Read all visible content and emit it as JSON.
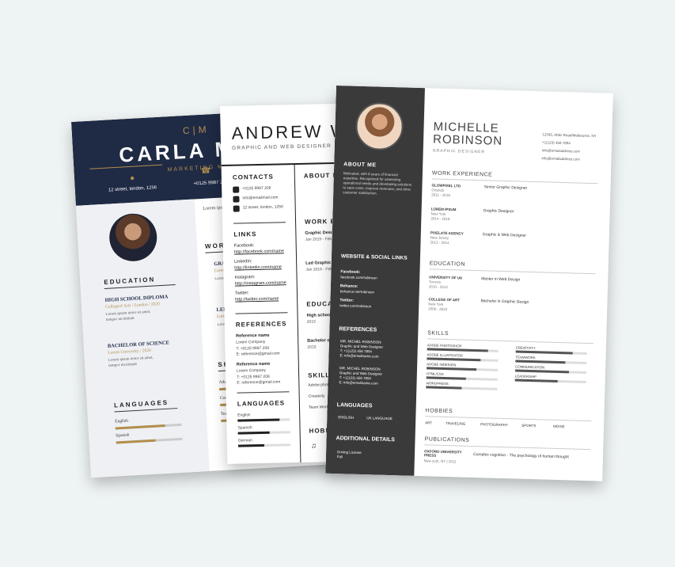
{
  "carla": {
    "monogram": "C|M",
    "name": "CARLA MO",
    "title": "MARKETING MANA",
    "address": "12 street, london, 1256",
    "phone": "+0125 9987 208",
    "education_heading": "EDUCATION",
    "edu": [
      {
        "title": "HIGH SCHOOL DIPLOMA",
        "sub": "Collegeof Arts / London / 2020",
        "text1": "Lorem ipsum dolor sit amet,",
        "text2": "tempor incididunt"
      },
      {
        "title": "BACHELOR OF SCIENCE",
        "sub": "Lorem University / 2020",
        "text1": "Lorem ipsum dolor sit amet,",
        "text2": "tempor incididunt"
      }
    ],
    "languages_heading": "LANGUAGES",
    "langs": [
      {
        "name": "English",
        "level": 0.75
      },
      {
        "name": "Spanish",
        "level": 0.6
      }
    ],
    "exp_heading": "WORK EXPE",
    "exp": [
      {
        "title": "GRAPHIC DE",
        "sub": "Lorem Compane"
      },
      {
        "title": "LED GRAPH",
        "sub": "Lorem Compa"
      }
    ],
    "skills_heading": "SKILLS",
    "skills": [
      {
        "name": "Adobe photosh",
        "level": 0.8
      },
      {
        "name": "Creativity",
        "level": 0.6
      },
      {
        "name": "Team Work",
        "level": 0.7
      }
    ],
    "intro": "Lorem ipsum dolor sit"
  },
  "andrew": {
    "name": "ANDREW WAT",
    "title": "GRAPHIC AND WEB DESIGNER",
    "contacts_heading": "CONTACTS",
    "contacts": [
      "+0125 9987 208",
      "info@emailmail.com",
      "12 street, london, 1256"
    ],
    "links_heading": "LINKS",
    "links": [
      {
        "label": "Facebook:",
        "url": "http://facebook.com/name"
      },
      {
        "label": "LinkedIn:",
        "url": "http://linkedin.com/name"
      },
      {
        "label": "Instagram:",
        "url": "http://instagram.com/name"
      },
      {
        "label": "Twitter:",
        "url": "http://twitter.com/name"
      }
    ],
    "references_heading": "REFERENCES",
    "refs": [
      {
        "name": "Reference name",
        "company": "Lorem Company",
        "t": "T: +0125 9987 208",
        "e": "E: reference@gmail.com"
      },
      {
        "name": "Reference name",
        "company": "Lorem Company",
        "t": "T: +0125 9987 208",
        "e": "E: reference@gmail.com"
      }
    ],
    "languages_heading": "LANGUAGES",
    "langs": [
      {
        "name": "English",
        "level": 0.8
      },
      {
        "name": "Spanish",
        "level": 0.6
      },
      {
        "name": "German",
        "level": 0.5
      }
    ],
    "about_heading": "ABOUT ME",
    "work_heading": "WORK EXP",
    "work": [
      {
        "title": "Graphic Designe",
        "dates": "Jan 2019 - Feb 20"
      },
      {
        "title": "Led Graphic De",
        "dates": "Jan 2018 - Feb 20"
      }
    ],
    "edu_heading": "EDUCATI",
    "edu": [
      {
        "title": "High school",
        "dates": "2019"
      },
      {
        "title": "Bachelor of",
        "dates": "2019"
      }
    ],
    "skills_heading": "SKILLS",
    "skills": [
      "Adobe photo",
      "Creativity",
      "Team Work"
    ],
    "hobbies_heading": "HOBBI"
  },
  "michelle": {
    "name1": "MICHELLE",
    "name2": "ROBINSON",
    "title": "GRAPHIC DESIGNER",
    "contacts": [
      "12345, Abbs Road/Melbourne, NY",
      "+1(123) 456 7894",
      "info@emailaddress.com",
      "info@emailaddress.com"
    ],
    "about_heading": "ABOUT ME",
    "about_text": "Motivated, with 8 years of financial expertise. Recognized for assessing operational needs and developing solutions to save costs, improve revenues, and drive customer satisfaction.",
    "web_heading": "WEBSITE & SOCIAL LINKS",
    "web": [
      {
        "label": "Facebook:",
        "url": "facebook.com/robinson"
      },
      {
        "label": "Behance:",
        "url": "behance.net/robinson"
      },
      {
        "label": "Twitter:",
        "url": "twitter.com/robinson"
      }
    ],
    "ref_heading": "REFERENCES",
    "refs": [
      {
        "name": "MR. MICHEL ROBINSON",
        "role": "Graphic and Web Designer",
        "t": "T: +1(123) 456 7894",
        "e": "E: info@emailname.com"
      },
      {
        "name": "MR. MICHEL ROBINSON",
        "role": "Graphic and Web Designer",
        "t": "T: +1(123) 456 7894",
        "e": "E: info@emailname.com"
      }
    ],
    "lang_heading": "LANGUAGES",
    "langs": [
      "ENGLISH",
      "UK LANGUAGE"
    ],
    "add_heading": "ADDITIONAL DETAILS",
    "add": [
      "Driving License",
      "Full"
    ],
    "work_heading": "WORK EXPERIENCE",
    "work": [
      {
        "company": "GLOWPIXEL LTD",
        "place": "Orlando",
        "years": "2011 - 2016",
        "role": "Senior Graphic Designer"
      },
      {
        "company": "LOREM IPSUM",
        "place": "New York",
        "years": "2014 - 2016",
        "role": "Graphic Designer"
      },
      {
        "company": "PIXELATE AGENCY",
        "place": "New Jersey",
        "years": "2013 - 2014",
        "role": "Graphic & Web Designer"
      }
    ],
    "edu_heading": "EDUCATION",
    "edu": [
      {
        "school": "UNIVERSITY OF UK",
        "place": "Toronto",
        "years": "2010 - 2012",
        "degree": "Master in Web Design"
      },
      {
        "school": "COLLEGE OF ART",
        "place": "New York",
        "years": "2006 - 2010",
        "degree": "Bachelor in Graphic Design"
      }
    ],
    "skills_heading": "SKILLS",
    "skills_left": [
      {
        "name": "ADOBE PHOTOSHOP",
        "level": 0.85
      },
      {
        "name": "ADOBE ILLUSTRATOR",
        "level": 0.75
      },
      {
        "name": "ADOBE INDESIGN",
        "level": 0.7
      },
      {
        "name": "HTML/CSS",
        "level": 0.55
      },
      {
        "name": "WORDPRESS",
        "level": 0.5
      }
    ],
    "skills_right": [
      {
        "name": "CREATIVITY",
        "level": 0.8
      },
      {
        "name": "TEAMWORK",
        "level": 0.7
      },
      {
        "name": "COMMUNICATION",
        "level": 0.75
      },
      {
        "name": "LEADERSHIP",
        "level": 0.6
      }
    ],
    "hobbies_heading": "HOBBIES",
    "hobbies": [
      "ART",
      "TRAVELING",
      "PHOTOGRAPHY",
      "SPORTS",
      "MOVIE"
    ],
    "pub_heading": "PUBLICATIONS",
    "pub_source": "OXFORD UNIVERSITY PRESS",
    "pub_place": "New york, NY  |  2011",
    "pub_title": "Complex cognition - The psychology of human thought"
  },
  "colors": {
    "navy": "#1f2a44",
    "gold": "#b38f4d",
    "dark": "#3a3a3a",
    "bg": "#eef3f3"
  }
}
